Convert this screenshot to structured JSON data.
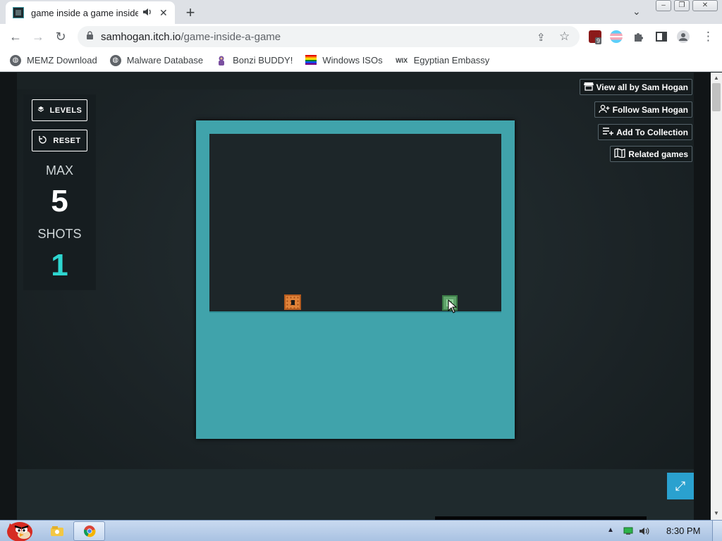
{
  "browser": {
    "tab": {
      "title": "game inside a game inside",
      "audio_icon": "speaker-icon",
      "close_glyph": "✕"
    },
    "new_tab_glyph": "+",
    "tab_dropdown_glyph": "⌄",
    "window_controls": {
      "minimize": "–",
      "restore": "❐",
      "close": "✕"
    },
    "nav": {
      "back": "←",
      "forward": "→",
      "reload": "↻"
    },
    "address": {
      "lock_icon": "🔒",
      "host": "samhogan.itch.io",
      "path": "/game-inside-a-game"
    },
    "omnibox_icons": {
      "share": "⇪",
      "star": "☆"
    },
    "extension_badge": "9",
    "menu_glyph": "⋮",
    "bookmarks": [
      {
        "label": "MEMZ Download",
        "icon": "globe-icon"
      },
      {
        "label": "Malware Database",
        "icon": "globe-icon"
      },
      {
        "label": "Bonzi BUDDY!",
        "icon": "bonzi-icon"
      },
      {
        "label": "Windows ISOs",
        "icon": "rainbow-flag-icon"
      },
      {
        "label": "Egyptian Embassy",
        "icon": "wix-icon"
      }
    ],
    "wix_text": "WIX"
  },
  "game": {
    "levels_label": "LEVELS",
    "reset_label": "RESET",
    "max_label": "MAX",
    "max_value": "5",
    "shots_label": "SHOTS",
    "shots_value": "1",
    "colors": {
      "frame": "#40a3ab",
      "inner": "#1d2629",
      "shots": "#2ed6d0",
      "player": "#e1843a",
      "goal": "#5fa36a"
    }
  },
  "actions": {
    "view_all": "View all by Sam Hogan",
    "follow": "Follow Sam Hogan",
    "add_collection": "Add To Collection",
    "related": "Related games"
  },
  "fullscreen_glyph": "⤢",
  "taskbar": {
    "clock": "8:30 PM",
    "tray_arrow": "▲"
  }
}
